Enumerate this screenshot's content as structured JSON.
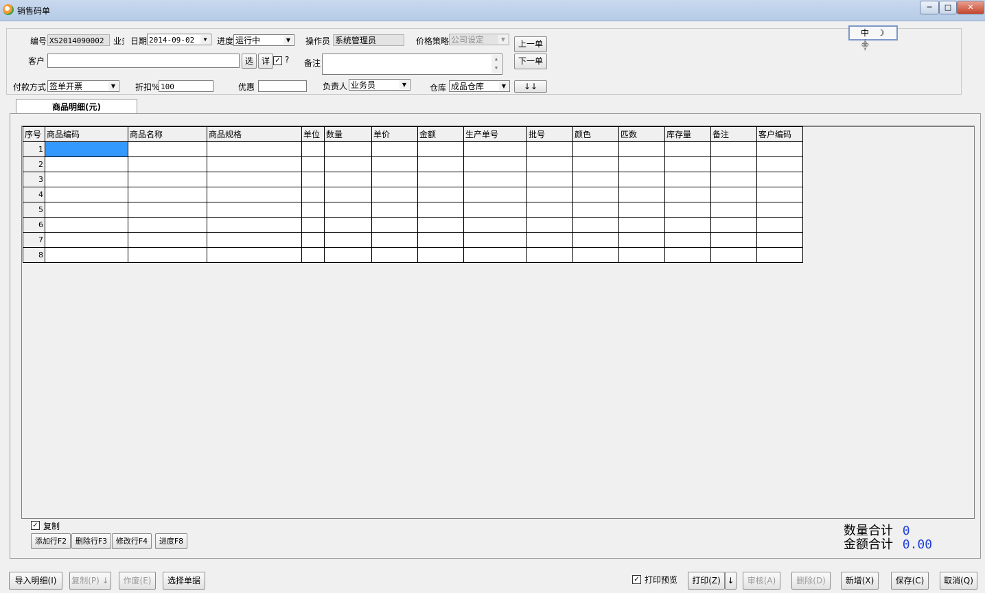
{
  "window": {
    "title": "销售码单",
    "minimize": "─",
    "maximize": "□",
    "close": "✕",
    "app_icon": "app-logo-icon"
  },
  "ime": {
    "text": "中 ☽ ⸎"
  },
  "header": {
    "number_label": "编号",
    "number_value": "XS2014090002",
    "business_label": "业务",
    "date_label": "日期",
    "date_value": "2014-09-02",
    "progress_label": "进度",
    "progress_value": "运行中",
    "operator_label": "操作员",
    "operator_value": "系统管理员",
    "price_policy_label": "价格策略",
    "price_policy_value": "公司设定",
    "prev_button": "上一单",
    "next_button": "下一单",
    "customer_label": "客户",
    "customer_value": "",
    "select_button": "选",
    "detail_button": "详",
    "question": "?",
    "remark_label": "备注",
    "remark_value": "",
    "payment_label": "付款方式",
    "payment_value": "签单开票",
    "discount_label": "折扣%",
    "discount_value": "100",
    "offer_label": "优惠",
    "offer_value": "",
    "owner_label": "负责人",
    "owner_value": "业务员",
    "warehouse_label": "仓库",
    "warehouse_value": "成品仓库",
    "down_button": "↓↓"
  },
  "tab": {
    "label": "商品明细(元)"
  },
  "grid": {
    "columns": [
      "序号",
      "商品编码",
      "商品名称",
      "商品规格",
      "单位",
      "数量",
      "单价",
      "金额",
      "生产单号",
      "批号",
      "颜色",
      "匹数",
      "库存量",
      "备注",
      "客户编码"
    ],
    "rows": [
      "1",
      "2",
      "3",
      "4",
      "5",
      "6",
      "7",
      "8"
    ]
  },
  "detail_actions": {
    "copy_label": "复制",
    "add_row": "添加行F2",
    "delete_row": "删除行F3",
    "edit_row": "修改行F4",
    "progress": "进度F8"
  },
  "totals": {
    "qty_label": "数量合计",
    "qty_value": "0",
    "amount_label": "金额合计",
    "amount_value": "0.00"
  },
  "footer": {
    "import_detail": "导入明细(I)",
    "copy": "复制(P)",
    "void": "作废(E)",
    "select_doc": "选择单据",
    "print_preview": "打印预览",
    "print": "打印(Z)",
    "audit": "审核(A)",
    "delete": "删除(D)",
    "new": "新增(X)",
    "save": "保存(C)",
    "cancel": "取消(Q)"
  }
}
